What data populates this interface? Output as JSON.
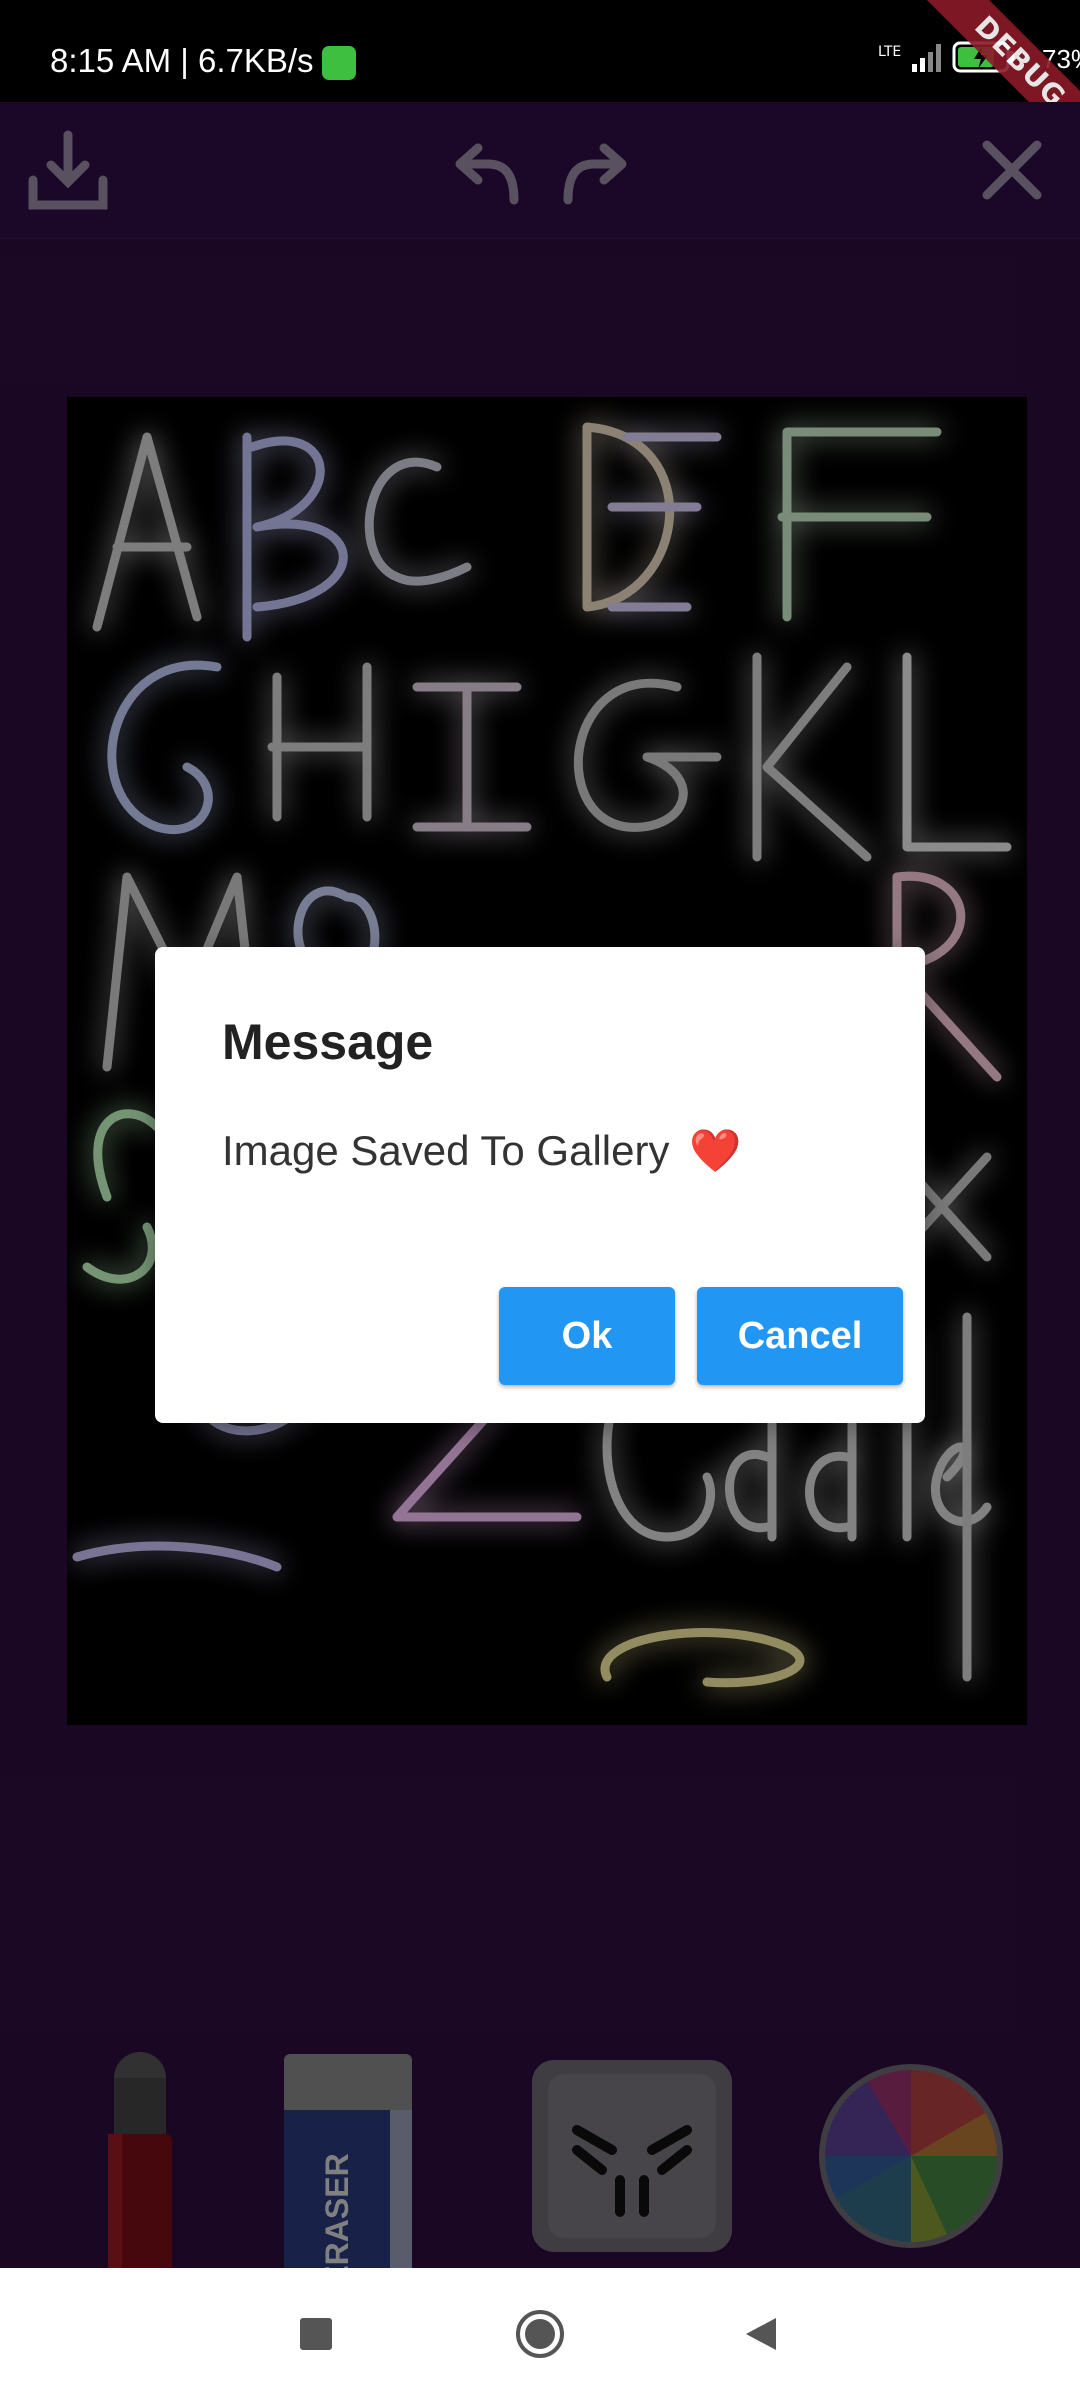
{
  "status_bar": {
    "time_speed": "8:15 AM | 6.7KB/s",
    "network": "LTE",
    "battery_pct": "73%",
    "debug_banner": "DEBUG"
  },
  "toolbar": {
    "icons": [
      "download-icon",
      "undo-icon",
      "redo-icon",
      "close-icon"
    ]
  },
  "dialog": {
    "title": "Message",
    "message": "Image Saved To Gallery",
    "emoji": "❤️",
    "ok_label": "Ok",
    "cancel_label": "Cancel"
  },
  "tools": {
    "eraser_label": "ERASER",
    "items": [
      "marker-tool",
      "eraser-tool",
      "brush-style-tool",
      "color-wheel-tool"
    ]
  },
  "colors": {
    "background": "#2c0d3f",
    "toolbar": "#2f0e46",
    "button": "#2196f3"
  }
}
